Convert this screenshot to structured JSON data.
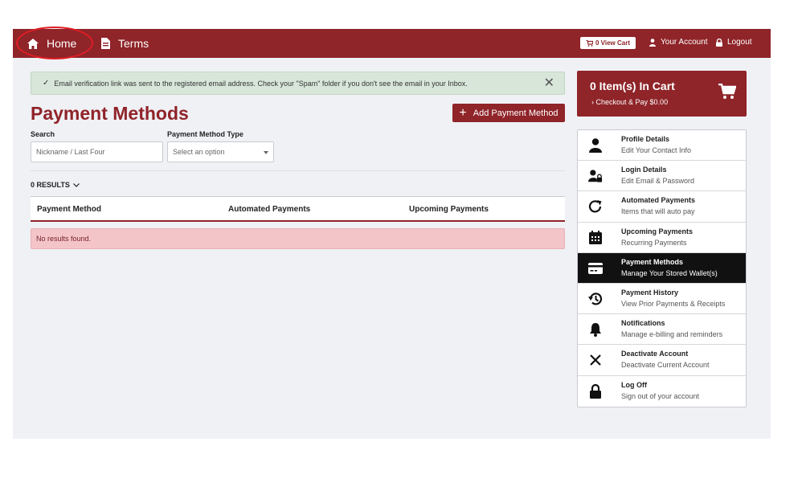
{
  "nav": {
    "home_label": "Home",
    "terms_label": "Terms",
    "cart_label": "0 View Cart",
    "account_label": "Your Account",
    "logout_label": "Logout"
  },
  "alert": {
    "message": "Email verification link was sent to the registered email address. Check your \"Spam\" folder if you don't see the email in your Inbox."
  },
  "page": {
    "title": "Payment Methods",
    "add_button": "Add Payment Method"
  },
  "filters": {
    "search_label": "Search",
    "search_placeholder": "Nickname / Last Four",
    "type_label": "Payment Method Type",
    "type_value": "Select an option"
  },
  "results": {
    "count_label": "0 RESULTS"
  },
  "table": {
    "columns": [
      "Payment Method",
      "Automated Payments",
      "Upcoming Payments"
    ],
    "empty_message": "No results found."
  },
  "cart": {
    "count_label": "0 Item(s) In Cart",
    "checkout_label": "Checkout & Pay $0.00"
  },
  "menu": {
    "items": [
      {
        "title": "Profile Details",
        "subtitle": "Edit Your Contact Info",
        "icon": "person-icon"
      },
      {
        "title": "Login Details",
        "subtitle": "Edit Email & Password",
        "icon": "user-lock-icon"
      },
      {
        "title": "Automated Payments",
        "subtitle": "Items that will auto pay",
        "icon": "refresh-icon"
      },
      {
        "title": "Upcoming Payments",
        "subtitle": "Recurring Payments",
        "icon": "calendar-icon"
      },
      {
        "title": "Payment Methods",
        "subtitle": "Manage Your Stored Wallet(s)",
        "icon": "credit-card-icon",
        "active": true
      },
      {
        "title": "Payment History",
        "subtitle": "View Prior Payments & Receipts",
        "icon": "history-icon"
      },
      {
        "title": "Notifications",
        "subtitle": "Manage e-billing and reminders",
        "icon": "bell-icon"
      },
      {
        "title": "Deactivate Account",
        "subtitle": "Deactivate Current Account",
        "icon": "close-icon"
      },
      {
        "title": "Log Off",
        "subtitle": "Sign out of your account",
        "icon": "lock-icon"
      }
    ]
  },
  "colors": {
    "brand": "#8f2429",
    "active_menu": "#111111",
    "alert_bg": "#d7e6d9",
    "empty_bg": "#f3c5c9"
  }
}
